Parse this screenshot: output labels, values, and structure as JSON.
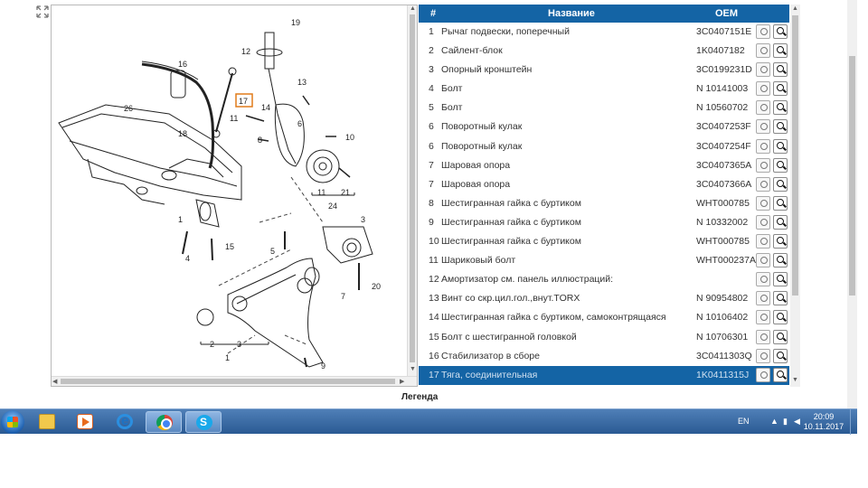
{
  "diagram": {
    "callouts": [
      "19",
      "12",
      "13",
      "16",
      "17",
      "14",
      "6",
      "11",
      "10",
      "26",
      "8",
      "18",
      "11",
      "21",
      "24",
      "3",
      "1",
      "5",
      "15",
      "4",
      "20",
      "7",
      "2",
      "3",
      "1",
      "9"
    ],
    "highlighted_callout": "17"
  },
  "parts_table": {
    "columns": {
      "num": "#",
      "name": "Название",
      "oem": "OEM"
    },
    "rows": [
      {
        "num": "1",
        "name": "Рычаг подвески, поперечный",
        "oem": "3C0407151E"
      },
      {
        "num": "2",
        "name": "Сайлент-блок",
        "oem": "1K0407182"
      },
      {
        "num": "3",
        "name": "Опорный кронштейн",
        "oem": "3C0199231D"
      },
      {
        "num": "4",
        "name": "Болт",
        "oem": "N 10141003"
      },
      {
        "num": "5",
        "name": "Болт",
        "oem": "N 10560702"
      },
      {
        "num": "6",
        "name": "Поворотный кулак",
        "oem": "3C0407253F"
      },
      {
        "num": "6",
        "name": "Поворотный кулак",
        "oem": "3C0407254F"
      },
      {
        "num": "7",
        "name": "Шаровая опора",
        "oem": "3C0407365A"
      },
      {
        "num": "7",
        "name": "Шаровая опора",
        "oem": "3C0407366A"
      },
      {
        "num": "8",
        "name": "Шестигранная гайка с буртиком",
        "oem": "WHT000785"
      },
      {
        "num": "9",
        "name": "Шестигранная гайка с буртиком",
        "oem": "N 10332002"
      },
      {
        "num": "10",
        "name": "Шестигранная гайка с буртиком",
        "oem": "WHT000785"
      },
      {
        "num": "11",
        "name": "Шариковый болт",
        "oem": "WHT000237A"
      },
      {
        "num": "12",
        "name": "Амортизатор см. панель иллюстраций:",
        "oem": ""
      },
      {
        "num": "13",
        "name": "Винт со скр.цил.гол.,внут.TORX",
        "oem": "N 90954802"
      },
      {
        "num": "14",
        "name": "Шестигранная гайка с буртиком, самоконтрящаяся",
        "oem": "N 10106402"
      },
      {
        "num": "15",
        "name": "Болт с шестигранной головкой",
        "oem": "N 10706301"
      },
      {
        "num": "16",
        "name": "Стабилизатор в сборе",
        "oem": "3C0411303Q"
      },
      {
        "num": "17",
        "name": "Тяга, соединительная",
        "oem": "1K0411315J"
      }
    ],
    "selected_row": 18
  },
  "legend_label": "Легенда",
  "taskbar": {
    "apps": [
      "folder-icon",
      "media-player-icon",
      "internet-explorer-icon",
      "chrome-icon",
      "skype-icon"
    ],
    "language": "EN",
    "time": "20:09",
    "date": "10.11.2017"
  },
  "colors": {
    "header_blue": "#1464a5",
    "highlight_orange": "#e07b1a"
  }
}
